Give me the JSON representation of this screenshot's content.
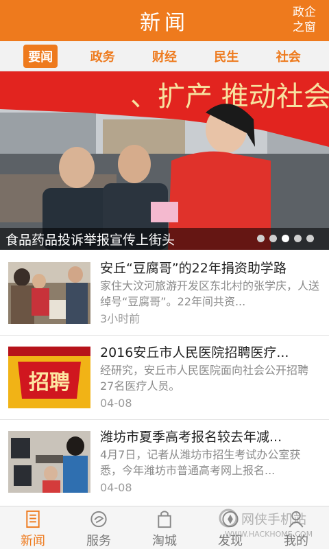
{
  "header": {
    "title": "新闻",
    "link_label": "政企\n之窗",
    "link_line1": "政企",
    "link_line2": "之窗"
  },
  "tabs": [
    {
      "label": "要闻",
      "active": true
    },
    {
      "label": "政务",
      "active": false
    },
    {
      "label": "财经",
      "active": false
    },
    {
      "label": "民生",
      "active": false
    },
    {
      "label": "社会",
      "active": false
    }
  ],
  "banner": {
    "caption": "食品药品投诉举报宣传上街头",
    "slide_count": 5,
    "active_slide": 3,
    "sign_text": "、扩产 推动社会共治"
  },
  "news": [
    {
      "title": "安丘“豆腐哥”的22年捐资助学路",
      "desc": "家住大汶河旅游开发区东北村的张学庆，人送绰号“豆腐哥”。22年间共资...",
      "time": "3小时前"
    },
    {
      "title": "2016安丘市人民医院招聘医疗...",
      "desc": "经研究，安丘市人民医院面向社会公开招聘27名医疗人员。",
      "time": "04-08",
      "thumb_text": "招聘"
    },
    {
      "title": "潍坊市夏季高考报名较去年减...",
      "desc": "4月7日，记者从潍坊市招生考试办公室获悉，今年潍坊市普通高考网上报名...",
      "time": "04-08"
    }
  ],
  "bottom_nav": [
    {
      "label": "新闻",
      "icon": "news-icon",
      "active": true
    },
    {
      "label": "服务",
      "icon": "service-icon",
      "active": false
    },
    {
      "label": "淘城",
      "icon": "shopping-bag-icon",
      "active": false
    },
    {
      "label": "发现",
      "icon": "discover-icon",
      "active": false
    },
    {
      "label": "我的",
      "icon": "profile-icon",
      "active": false
    }
  ],
  "watermark": {
    "line1": "网侠手机站",
    "line2": "WWW.HACKHOME.COM"
  },
  "colors": {
    "accent": "#ee7a1d",
    "header_bg": "#ee7a1d",
    "tab_bar_bg": "#f2f2f2",
    "text_primary": "#222222",
    "text_secondary": "#8a8a8a"
  }
}
